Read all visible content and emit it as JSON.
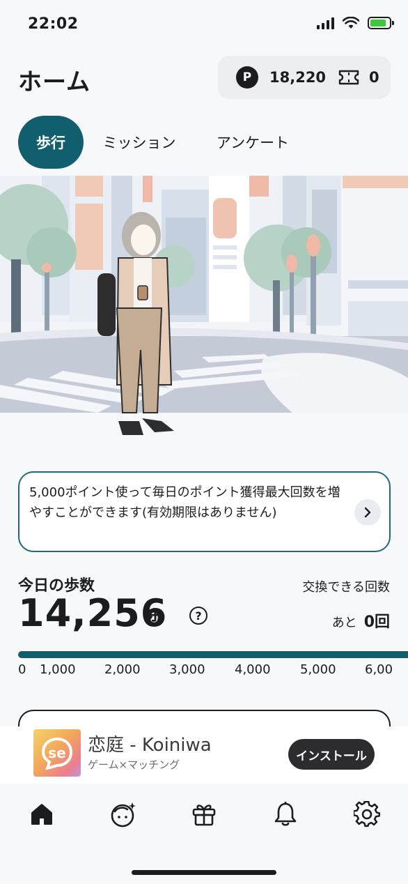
{
  "status_bar": {
    "time": "22:02"
  },
  "header": {
    "title": "ホーム",
    "points": "18,220",
    "tickets": "0"
  },
  "tabs": [
    {
      "label": "歩行",
      "active": true
    },
    {
      "label": "ミッション",
      "active": false
    },
    {
      "label": "アンケート",
      "active": false
    }
  ],
  "banner": {
    "text": "5,000ポイント使って毎日のポイント獲得最大回数を増やすことができます(有効期限はありません)"
  },
  "steps": {
    "label": "今日の歩数",
    "value": "14,256",
    "unit": "歩",
    "exchange_label": "交換できる回数",
    "remaining_prefix": "あと",
    "remaining_count": "0回",
    "progress_fraction": 1.0,
    "ticks": [
      "0",
      "1,000",
      "2,000",
      "3,000",
      "4,000",
      "5,000",
      "6,00"
    ]
  },
  "ad": {
    "title": "恋庭 - Koiniwa",
    "subtitle": "ゲーム×マッチング",
    "install_label": "インストール"
  },
  "bottom_nav": [
    "home-icon",
    "face-sparkle-icon",
    "gift-icon",
    "bell-icon",
    "gear-icon"
  ],
  "colors": {
    "accent": "#115e6e",
    "background": "#f7f8fa",
    "text": "#1c1c1e"
  }
}
